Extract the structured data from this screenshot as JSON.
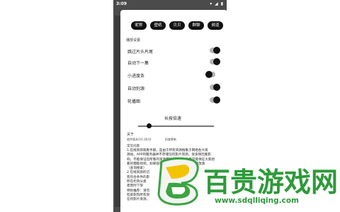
{
  "status": {
    "time": "3:09",
    "icons": "▾ ◢ ▮"
  },
  "tabs": [
    "昵称",
    "壁纸",
    "贝贝",
    "群聊",
    "频道"
  ],
  "settings": {
    "section_title": "播放设置",
    "rows": [
      {
        "label": "跳过片头片尾",
        "on": true
      },
      {
        "label": "自动下一集",
        "on": true
      },
      {
        "label": "小进度条",
        "on": false
      },
      {
        "label": "自动别源",
        "on": true
      },
      {
        "label": "轮播图",
        "on": true
      }
    ],
    "speed_label": "长按倍速",
    "speed_level": 0.12
  },
  "about": {
    "title": "关于",
    "version": "软件版本(10.18.0)",
    "update": "检查更新"
  },
  "faq": {
    "title": "常见问题",
    "lines": [
      "1.在线资源观看手册，是由于所有资源搜集于网络各大资",
      "源站，APP的服务器并不存储任何影片资源，很多频因素影",
      "响，不能保证您所看的资源都能播放，只能尽可能保证大家想",
      "看的都能找到，如果观看不顺请稍后或切换其他播放源",
      "（查询搜索）",
      "2.在线资源的切",
      "有符合条件的影",
      "所在栏目分类",
      "者暂时下架",
      "特别推荐：请勿",
      "检索影院所有资",
      "任何影片资源，"
    ]
  },
  "watermark": {
    "title": "百贵游戏网",
    "url": "www.sdqlliqing.com"
  },
  "colors": {
    "brand_green": "#2e9a3a",
    "tab_bg": "#111111",
    "toggle_track": "#b5b5b5"
  }
}
